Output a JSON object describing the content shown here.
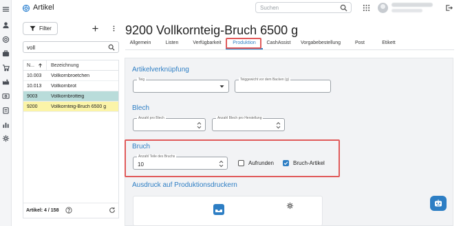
{
  "header": {
    "app_title": "Artikel",
    "search_placeholder": "Suchen"
  },
  "left_panel": {
    "filter_label": "Filter",
    "filter_value": "voll",
    "columns": [
      "N...",
      "Bezeichnung"
    ],
    "rows": [
      {
        "nr": "10.003",
        "name": "Vollkornbroetchen"
      },
      {
        "nr": "10.013",
        "name": "Vollkornbrot"
      },
      {
        "nr": "9003",
        "name": "Vollkornbrotteig"
      },
      {
        "nr": "9200",
        "name": "Vollkornteig-Bruch 6500 g"
      }
    ],
    "count_label": "Artikel: 4 / 158"
  },
  "main": {
    "title": "9200 Vollkornteig-Bruch 6500 g",
    "tabs": [
      "Allgemein",
      "Listen",
      "Verfügbarkeit",
      "Produktion",
      "CashAssist",
      "Vorgabebestellung",
      "Post",
      "Etikett"
    ],
    "active_tab": "Produktion"
  },
  "sections": {
    "artikel": {
      "title": "Artikelverknüpfung",
      "teig_label": "Teig",
      "teig_value": "",
      "gewicht_label": "Teiggewicht vor dem Backen (g)",
      "gewicht_value": ""
    },
    "blech": {
      "title": "Blech",
      "pro_blech_label": "Anzahl pro Blech",
      "pro_blech_value": "",
      "herstellung_label": "Anzahl Blech pro Herstellung",
      "herstellung_value": ""
    },
    "bruch": {
      "title": "Bruch",
      "teile_label": "Anzahl Teile des Bruchs",
      "teile_value": "10",
      "aufrunden_label": "Aufrunden",
      "aufrunden_checked": false,
      "bruch_artikel_label": "Bruch-Artikel",
      "bruch_artikel_checked": true
    },
    "ausdruck": {
      "title": "Ausdruck auf Produktionsdruckern"
    }
  },
  "colors": {
    "accent": "#2d7ec4",
    "highlight": "#e05a5a",
    "row_teal": "#b9dcda",
    "row_yellow": "#fbf4a8"
  }
}
